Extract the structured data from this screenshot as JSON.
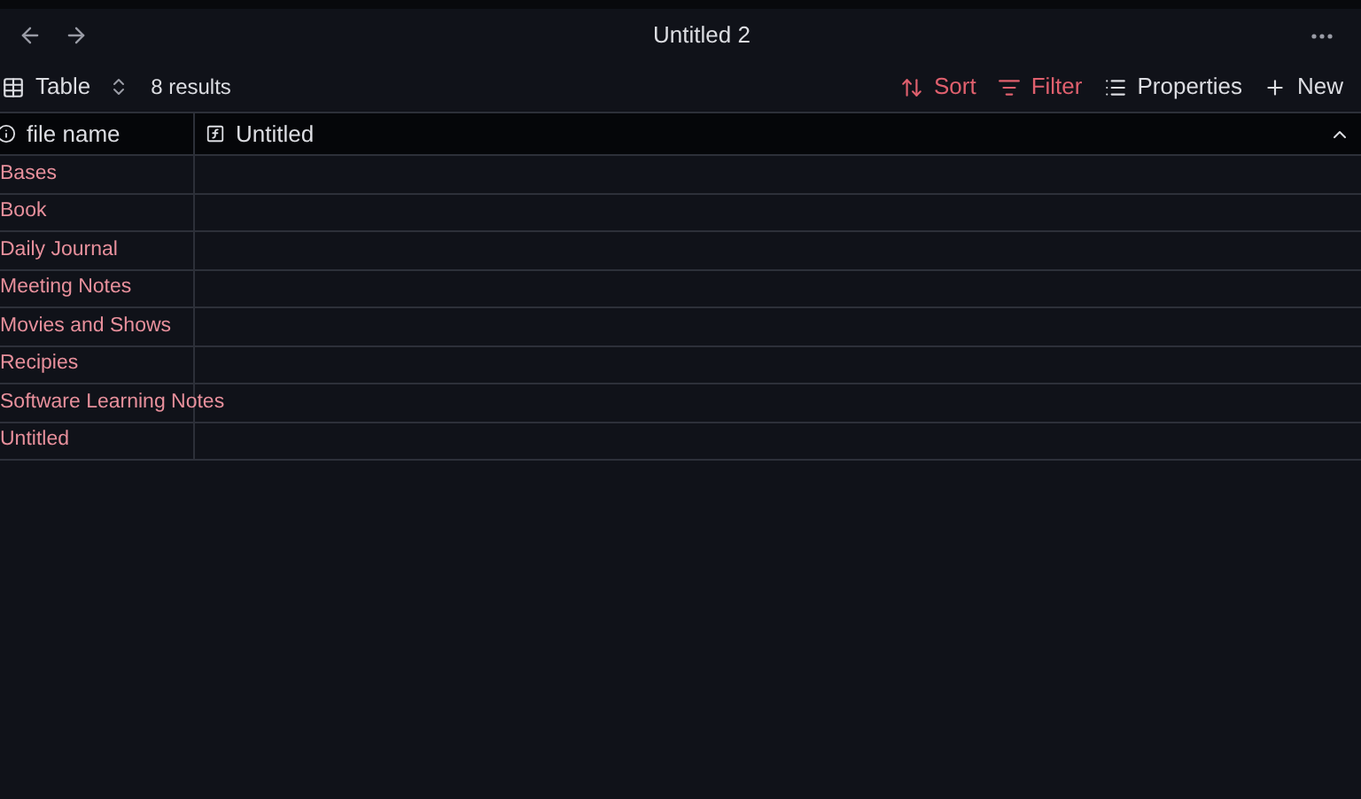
{
  "window": {
    "title": "Untitled 2"
  },
  "view": {
    "name": "Table",
    "results": "8 results"
  },
  "toolbar": [
    {
      "kind": "sort",
      "label": "Sort",
      "active": true
    },
    {
      "kind": "filter",
      "label": "Filter",
      "active": true
    },
    {
      "kind": "properties",
      "label": "Properties",
      "active": false
    },
    {
      "kind": "new",
      "label": "New",
      "active": false
    }
  ],
  "table": {
    "columns": [
      {
        "kind": "info",
        "label": "file name"
      },
      {
        "kind": "formula",
        "label": "Untitled"
      }
    ],
    "rows": [
      [
        "Bases",
        ""
      ],
      [
        "Book",
        ""
      ],
      [
        "Daily Journal",
        ""
      ],
      [
        "Meeting Notes",
        ""
      ],
      [
        "Movies and Shows",
        ""
      ],
      [
        "Recipies",
        ""
      ],
      [
        "Software Learning Notes",
        ""
      ],
      [
        "Untitled",
        ""
      ]
    ]
  }
}
